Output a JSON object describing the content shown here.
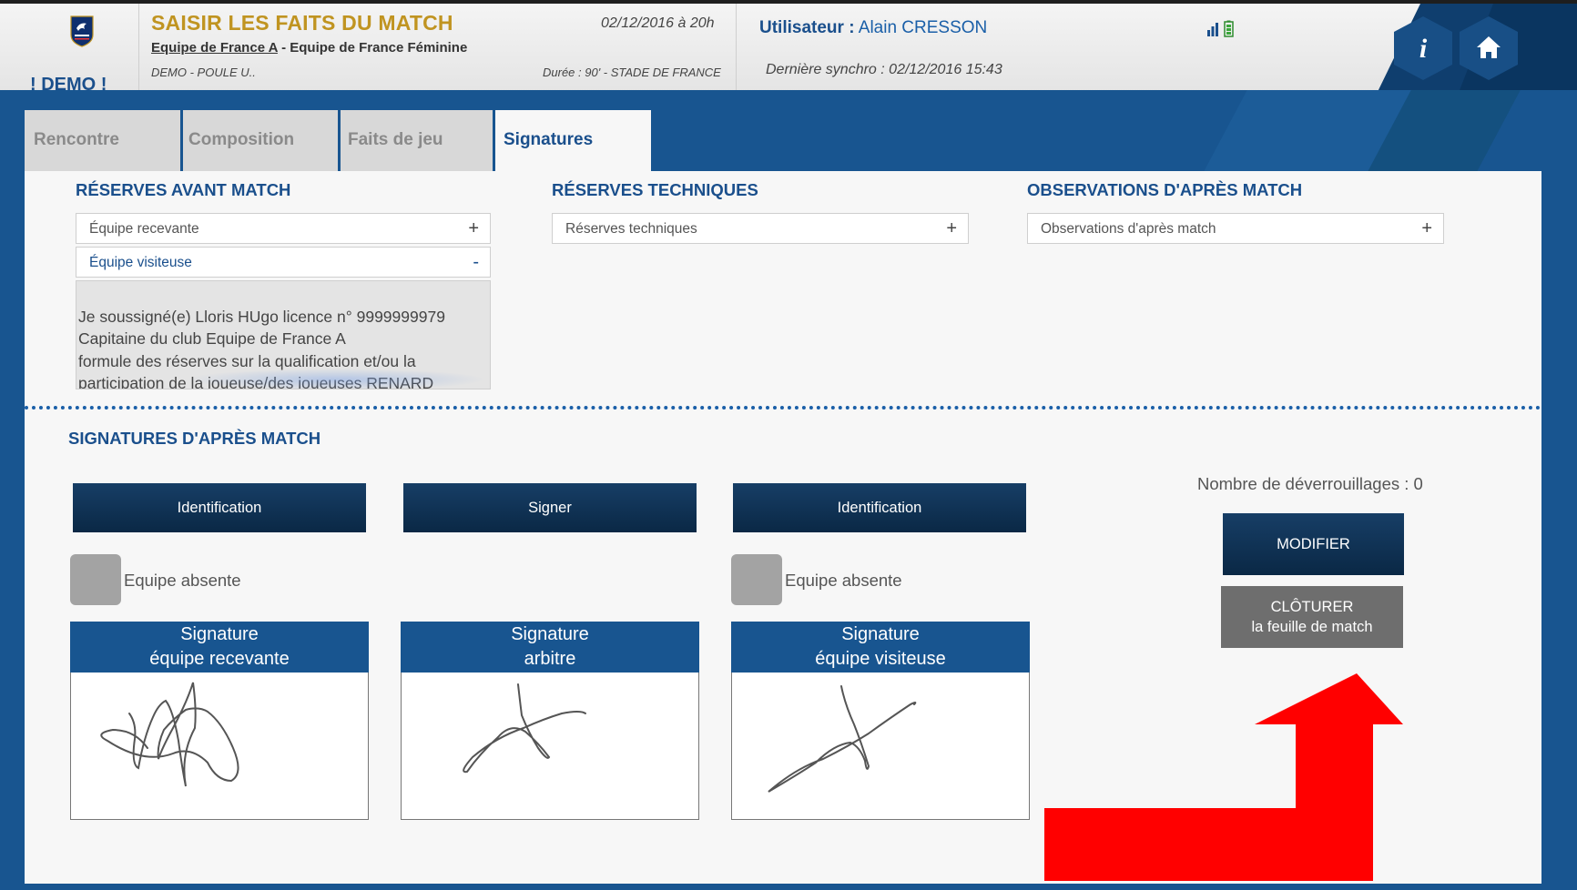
{
  "header": {
    "title": "SAISIR LES FAITS DU MATCH",
    "home_team": "Equipe de France A",
    "team_separator": " - ",
    "away_team": "Equipe de France Féminine",
    "competition": "DEMO - POULE U..",
    "date": "02/12/2016 à 20h",
    "duree": "Durée : 90' - STADE DE FRANCE",
    "user_label": "Utilisateur :",
    "user_name": "Alain CRESSON",
    "sync": "Dernière synchro : 02/12/2016 15:43",
    "demo": "! DEMO !",
    "info_glyph": "i"
  },
  "icons": {
    "info": "info-icon",
    "home": "home-icon",
    "signal": "signal-bars-icon",
    "battery": "battery-icon",
    "logo": "fff-crest-logo"
  },
  "tabs": [
    {
      "label": "Rencontre",
      "active": false
    },
    {
      "label": "Composition",
      "active": false
    },
    {
      "label": "Faits de jeu",
      "active": false
    },
    {
      "label": "Signatures",
      "active": true
    }
  ],
  "reserves_avant": {
    "title": "RÉSERVES AVANT MATCH",
    "field_recevante": "Équipe recevante",
    "field_recevante_toggle": "+",
    "field_visiteuse": "Équipe visiteuse",
    "field_visiteuse_toggle": "-",
    "text": "Je soussigné(e) Lloris HUgo licence n° 9999999979\nCapitaine du club Equipe de France A\nformule des réserves sur la qualification et/ou la\nparticipation de la joueuse/des joueuses RENARD\nWendie, du club Equipe de France Féminine, pour le"
  },
  "reserves_tech": {
    "title": "RÉSERVES TECHNIQUES",
    "field": "Réserves techniques",
    "toggle": "+"
  },
  "observations": {
    "title": "OBSERVATIONS D'APRÈS MATCH",
    "field": "Observations d'après match",
    "toggle": "+"
  },
  "signatures": {
    "title": "SIGNATURES D'APRÈS MATCH",
    "btn_ident_1": "Identification",
    "btn_signer": "Signer",
    "btn_ident_2": "Identification",
    "absent_1": "Equipe absente",
    "absent_2": "Equipe absente",
    "box_1": {
      "line1": "Signature",
      "line2": "équipe recevante"
    },
    "box_2": {
      "line1": "Signature",
      "line2": "arbitre"
    },
    "box_3": {
      "line1": "Signature",
      "line2": "équipe visiteuse"
    },
    "unlock_count": "Nombre de déverrouillages : 0",
    "btn_modifier": "MODIFIER",
    "btn_cloturer_1": "CLÔTURER",
    "btn_cloturer_2": "la feuille de match"
  },
  "colors": {
    "brand_blue": "#185590",
    "title_gold": "#c09421",
    "dark_button": "#0a2845",
    "grey_button": "#6e6e6e",
    "arrow_red": "#ff0000",
    "dotted_separator": "#1a5fa8"
  }
}
